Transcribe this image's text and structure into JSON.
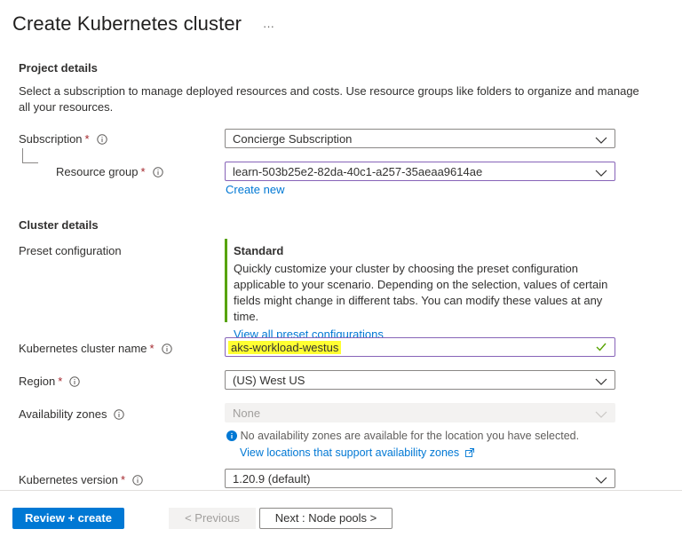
{
  "page": {
    "title": "Create Kubernetes cluster",
    "more_label": "···"
  },
  "project": {
    "heading": "Project details",
    "description": "Select a subscription to manage deployed resources and costs. Use resource groups like folders to organize and manage all your resources.",
    "subscription": {
      "label": "Subscription",
      "value": "Concierge Subscription"
    },
    "resource_group": {
      "label": "Resource group",
      "value": "learn-503b25e2-82da-40c1-a257-35aeaa9614ae",
      "create_new": "Create new"
    }
  },
  "cluster": {
    "heading": "Cluster details",
    "preset": {
      "label": "Preset configuration",
      "title": "Standard",
      "description": "Quickly customize your cluster by choosing the preset configuration applicable to your scenario. Depending on the selection, values of certain fields might change in different tabs. You can modify these values at any time.",
      "link": "View all preset configurations"
    },
    "name": {
      "label": "Kubernetes cluster name",
      "value": "aks-workload-westus"
    },
    "region": {
      "label": "Region",
      "value": "(US) West US"
    },
    "zones": {
      "label": "Availability zones",
      "value": "None",
      "notice": "No availability zones are available for the location you have selected.",
      "link": "View locations that support availability zones"
    },
    "version": {
      "label": "Kubernetes version",
      "value": "1.20.9 (default)"
    }
  },
  "footer": {
    "review_create": "Review + create",
    "previous": "< Previous",
    "next": "Next : Node pools >"
  },
  "colors": {
    "accent": "#0078d4",
    "required": "#a4262c",
    "preset_bar": "#57a300",
    "highlight": "#ffff33",
    "focus_border": "#8764b8"
  }
}
